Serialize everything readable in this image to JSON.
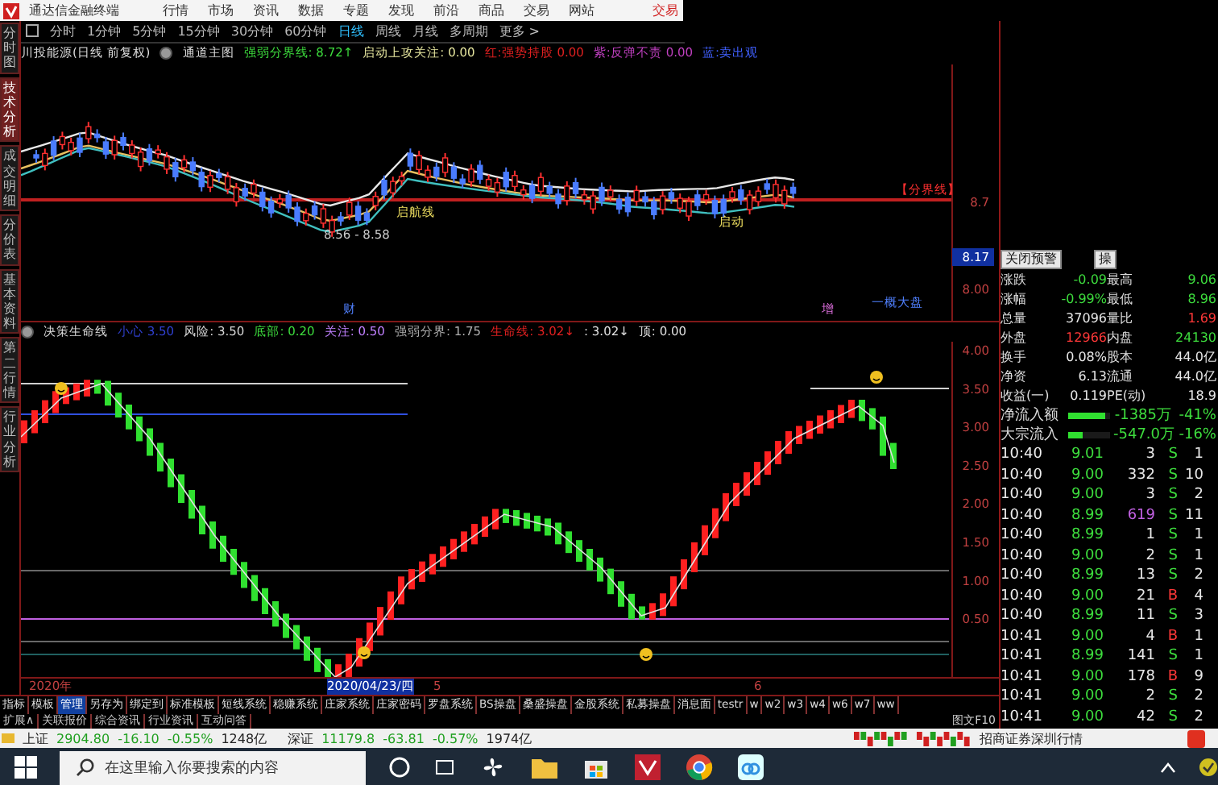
{
  "menu_bar": {
    "title": "通达信金融终端",
    "items": [
      "行情",
      "市场",
      "资讯",
      "数据",
      "专题",
      "发现",
      "前沿",
      "商品",
      "交易",
      "网站"
    ],
    "trade_link": "交易"
  },
  "side_tabs": [
    {
      "label": "分时图",
      "selected": false
    },
    {
      "label": "技术分析",
      "selected": true
    },
    {
      "label": "成交明细",
      "selected": false
    },
    {
      "label": "分价表",
      "selected": false
    },
    {
      "label": "基本资料",
      "selected": false
    },
    {
      "label": "第二行情",
      "selected": false
    },
    {
      "label": "行业分析",
      "selected": false
    }
  ],
  "periods": [
    {
      "label": "分时",
      "selected": false
    },
    {
      "label": "1分钟",
      "selected": false
    },
    {
      "label": "5分钟",
      "selected": false
    },
    {
      "label": "15分钟",
      "selected": false
    },
    {
      "label": "30分钟",
      "selected": false
    },
    {
      "label": "60分钟",
      "selected": false
    },
    {
      "label": "日线",
      "selected": true
    },
    {
      "label": "周线",
      "selected": false
    },
    {
      "label": "月线",
      "selected": false
    },
    {
      "label": "多周期",
      "selected": false
    },
    {
      "label": "更多 >",
      "selected": false
    }
  ],
  "main_chart": {
    "stock": "川投能源(日线 前复权)",
    "template": "通道主图",
    "legend": [
      {
        "text": "强弱分界线: 8.72↑",
        "color": "#3ddc3d"
      },
      {
        "text": "启动上攻关注: 0.00",
        "color": "#e8e8a0"
      },
      {
        "text": "红:强势持股 0.00",
        "color": "#e02020"
      },
      {
        "text": "紫:反弹不责 0.00",
        "color": "#c040c0"
      },
      {
        "text": "蓝:卖出观",
        "color": "#4060ff"
      }
    ],
    "annotations": [
      "8.56 - 8.58",
      "启航线",
      "启动",
      "【分界线】",
      "财",
      "增",
      "一概大盘"
    ],
    "axis": [
      {
        "label": "8.7",
        "highlighted": false
      },
      {
        "label": "8.17",
        "highlighted": true
      },
      {
        "label": "8.00",
        "highlighted": false
      }
    ]
  },
  "indicator_chart": {
    "name": "决策生命线",
    "legend": [
      {
        "text": "小心 3.50",
        "color": "#3040d0"
      },
      {
        "text": "风险: 3.50",
        "color": "#d8d8d8"
      },
      {
        "text": "底部: 0.20",
        "color": "#3ddc3d"
      },
      {
        "text": "关注: 0.50",
        "color": "#c080ff"
      },
      {
        "text": "强弱分界: 1.75",
        "color": "#b0b0b0"
      },
      {
        "text": "生命线: 3.02↓",
        "color": "#e02020"
      },
      {
        "text": ": 3.02↓",
        "color": "#e0e0e0"
      },
      {
        "text": "顶: 0.00",
        "color": "#e0e0e0"
      }
    ],
    "axis": [
      "4.00",
      "3.50",
      "3.00",
      "2.50",
      "2.00",
      "1.50",
      "1.00",
      "0.50"
    ]
  },
  "date_axis": [
    {
      "label": "2020年",
      "highlighted": false
    },
    {
      "label": "2020/04/23/四",
      "highlighted": true
    },
    {
      "label": "5",
      "highlighted": false
    },
    {
      "label": "6",
      "highlighted": false
    }
  ],
  "bottom_tabs": [
    {
      "label": "指标",
      "selected": false
    },
    {
      "label": "模板",
      "selected": false
    },
    {
      "label": "管理",
      "selected": true
    },
    {
      "label": "另存为",
      "selected": false
    },
    {
      "label": "绑定到",
      "selected": false
    },
    {
      "label": "标准模板",
      "selected": false
    },
    {
      "label": "短线系统",
      "selected": false
    },
    {
      "label": "稳赚系统",
      "selected": false
    },
    {
      "label": "庄家系统",
      "selected": false
    },
    {
      "label": "庄家密码",
      "selected": false
    },
    {
      "label": "罗盘系统",
      "selected": false
    },
    {
      "label": "BS操盘",
      "selected": false
    },
    {
      "label": "桑盛操盘",
      "selected": false
    },
    {
      "label": "金股系统",
      "selected": false
    },
    {
      "label": "私募操盘",
      "selected": false
    },
    {
      "label": "消息面",
      "selected": false
    },
    {
      "label": "testr",
      "selected": false
    },
    {
      "label": "w",
      "selected": false
    },
    {
      "label": "w2",
      "selected": false
    },
    {
      "label": "w3",
      "selected": false
    },
    {
      "label": "w4",
      "selected": false
    },
    {
      "label": "w6",
      "selected": false
    },
    {
      "label": "w7",
      "selected": false
    },
    {
      "label": "ww",
      "selected": false
    }
  ],
  "info_tabs": [
    "扩展∧",
    "关联报价",
    "综合资讯",
    "行业资讯",
    "互动问答"
  ],
  "f10_link": "图文F10",
  "quote_panel": {
    "buttons": [
      "关闭预警",
      "操"
    ],
    "fields": [
      {
        "label": "涨跌",
        "value": "-0.09",
        "color": "#3ddc3d"
      },
      {
        "label": "最高",
        "value": "9.06",
        "color": "#3ddc3d"
      },
      {
        "label": "涨幅",
        "value": "-0.99%",
        "color": "#3ddc3d"
      },
      {
        "label": "最低",
        "value": "8.96",
        "color": "#3ddc3d"
      },
      {
        "label": "总量",
        "value": "37096",
        "color": "#e8e8e8"
      },
      {
        "label": "量比",
        "value": "1.69",
        "color": "#ff3838"
      },
      {
        "label": "外盘",
        "value": "12966",
        "color": "#ff3838"
      },
      {
        "label": "内盘",
        "value": "24130",
        "color": "#3ddc3d"
      },
      {
        "label": "换手",
        "value": "0.08%",
        "color": "#e8e8e8"
      },
      {
        "label": "股本",
        "value": "44.0亿",
        "color": "#e8e8e8"
      },
      {
        "label": "净资",
        "value": "6.13",
        "color": "#e8e8e8"
      },
      {
        "label": "流通",
        "value": "44.0亿",
        "color": "#e8e8e8"
      },
      {
        "label": "收益(一)",
        "value": "0.119",
        "color": "#e8e8e8"
      },
      {
        "label": "PE(动)",
        "value": "18.9",
        "color": "#e8e8e8"
      }
    ],
    "flows": [
      {
        "label": "净流入额",
        "level": 0.9,
        "amount": "-1385万",
        "percent": "-41%"
      },
      {
        "label": "大宗流入",
        "level": 0.35,
        "amount": "-547.0万",
        "percent": "-16%"
      }
    ],
    "ticks": [
      {
        "time": "10:40",
        "price": "9.01",
        "volume": "3",
        "large": false,
        "side": "S",
        "count": "1"
      },
      {
        "time": "10:40",
        "price": "9.00",
        "volume": "332",
        "large": false,
        "side": "S",
        "count": "10"
      },
      {
        "time": "10:40",
        "price": "9.00",
        "volume": "3",
        "large": false,
        "side": "S",
        "count": "2"
      },
      {
        "time": "10:40",
        "price": "8.99",
        "volume": "619",
        "large": true,
        "side": "S",
        "count": "11"
      },
      {
        "time": "10:40",
        "price": "8.99",
        "volume": "1",
        "large": false,
        "side": "S",
        "count": "1"
      },
      {
        "time": "10:40",
        "price": "9.00",
        "volume": "2",
        "large": false,
        "side": "S",
        "count": "1"
      },
      {
        "time": "10:40",
        "price": "8.99",
        "volume": "13",
        "large": false,
        "side": "S",
        "count": "2"
      },
      {
        "time": "10:40",
        "price": "9.00",
        "volume": "21",
        "large": false,
        "side": "B",
        "count": "4"
      },
      {
        "time": "10:40",
        "price": "8.99",
        "volume": "11",
        "large": false,
        "side": "S",
        "count": "3"
      },
      {
        "time": "10:41",
        "price": "9.00",
        "volume": "4",
        "large": false,
        "side": "B",
        "count": "1"
      },
      {
        "time": "10:41",
        "price": "8.99",
        "volume": "141",
        "large": false,
        "side": "S",
        "count": "1"
      },
      {
        "time": "10:41",
        "price": "9.00",
        "volume": "178",
        "large": false,
        "side": "B",
        "count": "9"
      },
      {
        "time": "10:41",
        "price": "9.00",
        "volume": "2",
        "large": false,
        "side": "S",
        "count": "2"
      },
      {
        "time": "10:41",
        "price": "9.00",
        "volume": "42",
        "large": false,
        "side": "S",
        "count": "2"
      }
    ]
  },
  "status_bar": {
    "indices": [
      {
        "name": "上证",
        "value": "2904.80",
        "change": "-16.10",
        "percent": "-0.55%",
        "turnover": "1248亿"
      },
      {
        "name": "深证",
        "value": "11179.8",
        "change": "-63.81",
        "percent": "-0.57%",
        "turnover": "1974亿"
      }
    ],
    "server": "招商证券深圳行情"
  },
  "taskbar": {
    "search": {
      "placeholder": "在这里输入你要搜索的内容"
    }
  }
}
